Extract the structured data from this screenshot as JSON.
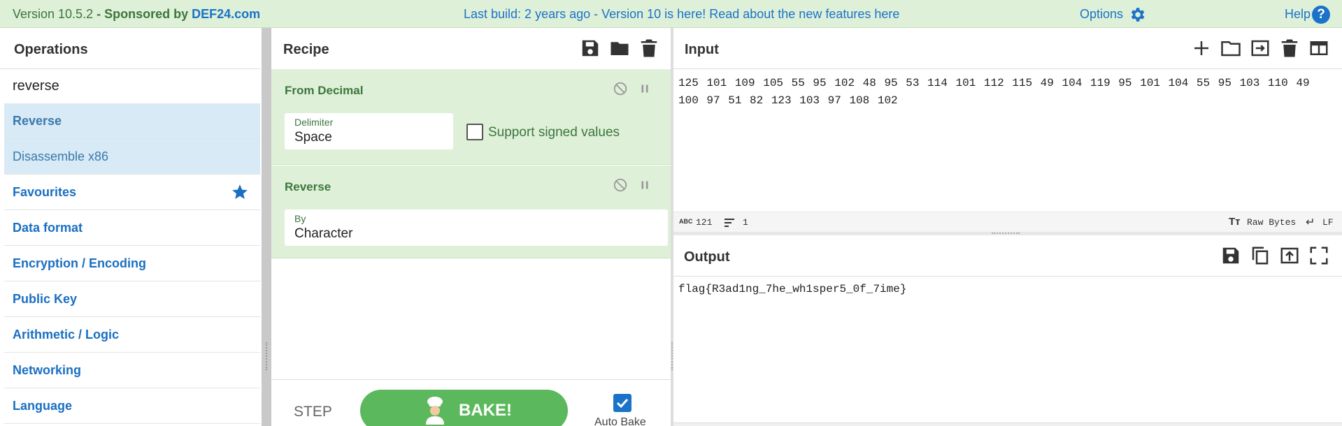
{
  "banner": {
    "version": "Version 10.5.2",
    "sponsor_prefix": " - Sponsored by ",
    "sponsor": "DEF24.com",
    "notice": "Last build: 2 years ago - Version 10 is here! Read about the new features here",
    "options_label": "Options",
    "help_label": "Help",
    "help_icon": "?"
  },
  "operations": {
    "title": "Operations",
    "search_value": "reverse",
    "results": [
      "Reverse",
      "Disassemble x86"
    ],
    "categories": [
      "Favourites",
      "Data format",
      "Encryption / Encoding",
      "Public Key",
      "Arithmetic / Logic",
      "Networking",
      "Language"
    ]
  },
  "recipe": {
    "title": "Recipe",
    "ingredients": [
      {
        "name": "From Decimal",
        "field_label": "Delimiter",
        "field_value": "Space",
        "checkbox_label": "Support signed values"
      },
      {
        "name": "Reverse",
        "field_label": "By",
        "field_value": "Character"
      }
    ],
    "step_label": "STEP",
    "bake_label": "BAKE!",
    "auto_bake_label": "Auto Bake"
  },
  "input": {
    "title": "Input",
    "text": "125 101 109 105 55 95 102 48 95 53 114 101 112 115 49 104 119 95 101 104 55 95 103 110 49 100 97 51 82 123 103 97 108 102",
    "length": "121",
    "lines": "1",
    "encoding": "Raw Bytes",
    "eol": "LF"
  },
  "output": {
    "title": "Output",
    "text": "flag{R3ad1ng_7he_wh1sper5_0f_7ime}"
  },
  "colors": {
    "accent_blue": "#1a73c8",
    "recipe_green": "#dff0d8",
    "bake_green": "#5cb85c"
  }
}
